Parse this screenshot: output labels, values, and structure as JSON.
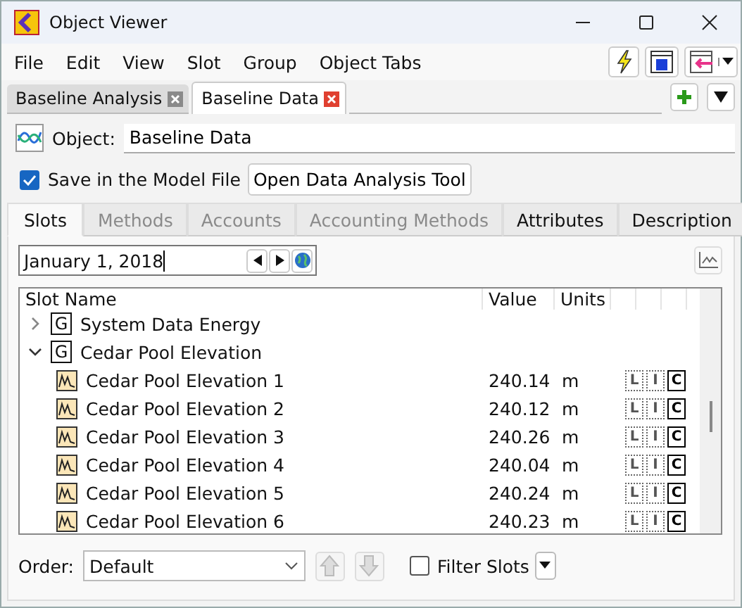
{
  "window": {
    "title": "Object Viewer"
  },
  "menu": [
    "File",
    "Edit",
    "View",
    "Slot",
    "Group",
    "Object Tabs"
  ],
  "doc_tabs": [
    {
      "label": "Baseline Analysis",
      "selected": false
    },
    {
      "label": "Baseline Data",
      "selected": true
    }
  ],
  "object": {
    "label": "Object:",
    "value": "Baseline Data"
  },
  "save_in_model": {
    "label": "Save in the Model File",
    "checked": true
  },
  "open_tool_button": "Open Data Analysis Tool",
  "tabs": [
    {
      "label": "Slots",
      "selected": true,
      "disabled": false
    },
    {
      "label": "Methods",
      "selected": false,
      "disabled": true
    },
    {
      "label": "Accounts",
      "selected": false,
      "disabled": true
    },
    {
      "label": "Accounting Methods",
      "selected": false,
      "disabled": true
    },
    {
      "label": "Attributes",
      "selected": false,
      "disabled": false
    },
    {
      "label": "Description",
      "selected": false,
      "disabled": false
    }
  ],
  "date": {
    "value": "January 1, 2018"
  },
  "table": {
    "columns": [
      "Slot Name",
      "Value",
      "Units"
    ],
    "rows": [
      {
        "kind": "group",
        "badge": "G",
        "name": "System Data Energy",
        "expanded": false
      },
      {
        "kind": "group",
        "badge": "G",
        "name": "Cedar Pool Elevation",
        "expanded": true,
        "children": [
          {
            "kind": "slot",
            "name": "Cedar Pool Elevation 1",
            "value": "240.14",
            "units": "m",
            "flags": [
              {
                "label": "L",
                "on": false
              },
              {
                "label": "I",
                "on": false
              },
              {
                "label": "C",
                "on": true
              }
            ]
          },
          {
            "kind": "slot",
            "name": "Cedar Pool Elevation 2",
            "value": "240.12",
            "units": "m",
            "flags": [
              {
                "label": "L",
                "on": false
              },
              {
                "label": "I",
                "on": false
              },
              {
                "label": "C",
                "on": true
              }
            ]
          },
          {
            "kind": "slot",
            "name": "Cedar Pool Elevation 3",
            "value": "240.26",
            "units": "m",
            "flags": [
              {
                "label": "L",
                "on": false
              },
              {
                "label": "I",
                "on": false
              },
              {
                "label": "C",
                "on": true
              }
            ]
          },
          {
            "kind": "slot",
            "name": "Cedar Pool Elevation 4",
            "value": "240.04",
            "units": "m",
            "flags": [
              {
                "label": "L",
                "on": false
              },
              {
                "label": "I",
                "on": false
              },
              {
                "label": "C",
                "on": true
              }
            ]
          },
          {
            "kind": "slot",
            "name": "Cedar Pool Elevation 5",
            "value": "240.24",
            "units": "m",
            "flags": [
              {
                "label": "L",
                "on": false
              },
              {
                "label": "I",
                "on": false
              },
              {
                "label": "C",
                "on": true
              }
            ]
          },
          {
            "kind": "slot",
            "name": "Cedar Pool Elevation 6",
            "value": "240.23",
            "units": "m",
            "flags": [
              {
                "label": "L",
                "on": false
              },
              {
                "label": "I",
                "on": false
              },
              {
                "label": "C",
                "on": true
              }
            ]
          }
        ]
      }
    ]
  },
  "order": {
    "label": "Order:",
    "value": "Default"
  },
  "filter_slots": {
    "label": "Filter Slots",
    "checked": false
  }
}
